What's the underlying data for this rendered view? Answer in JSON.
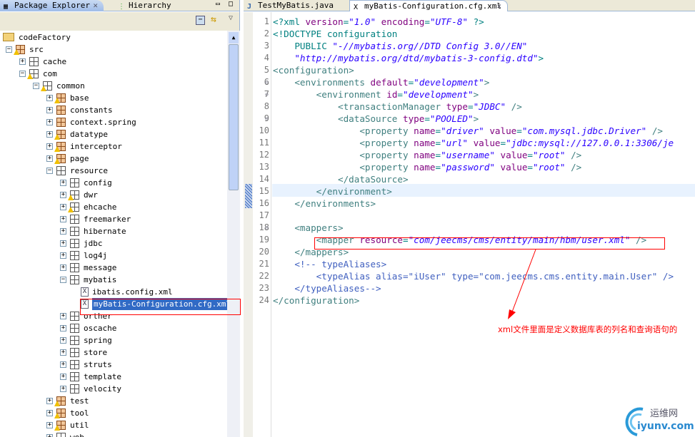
{
  "left_panel": {
    "tabs": [
      {
        "label": "Package Explorer",
        "icon": "package-explorer-icon"
      },
      {
        "label": "Hierarchy",
        "icon": "hierarchy-icon"
      }
    ],
    "tree": [
      {
        "label": "codeFactory",
        "level": 0,
        "type": "project",
        "expander": ""
      },
      {
        "label": "src",
        "level": 0,
        "type": "srcfolder",
        "expander": "-",
        "warn": true
      },
      {
        "label": "cache",
        "level": 1,
        "type": "pkg",
        "expander": "+"
      },
      {
        "label": "com",
        "level": 1,
        "type": "pkg",
        "expander": "-",
        "warn": true
      },
      {
        "label": "common",
        "level": 2,
        "type": "pkg",
        "expander": "-",
        "warn": true
      },
      {
        "label": "base",
        "level": 3,
        "type": "src",
        "expander": "+",
        "warn": true
      },
      {
        "label": "constants",
        "level": 3,
        "type": "src",
        "expander": "+"
      },
      {
        "label": "context.spring",
        "level": 3,
        "type": "src",
        "expander": "+"
      },
      {
        "label": "datatype",
        "level": 3,
        "type": "src",
        "expander": "+",
        "warn": true
      },
      {
        "label": "interceptor",
        "level": 3,
        "type": "src",
        "expander": "+",
        "warn": true
      },
      {
        "label": "page",
        "level": 3,
        "type": "src",
        "expander": "+",
        "warn": true
      },
      {
        "label": "resource",
        "level": 3,
        "type": "pkg",
        "expander": "-"
      },
      {
        "label": "config",
        "level": 4,
        "type": "pkg",
        "expander": "+"
      },
      {
        "label": "dwr",
        "level": 4,
        "type": "pkg",
        "expander": "+",
        "warn": true
      },
      {
        "label": "ehcache",
        "level": 4,
        "type": "pkg",
        "expander": "+",
        "warn": true
      },
      {
        "label": "freemarker",
        "level": 4,
        "type": "pkg",
        "expander": "+"
      },
      {
        "label": "hibernate",
        "level": 4,
        "type": "pkg",
        "expander": "+"
      },
      {
        "label": "jdbc",
        "level": 4,
        "type": "pkg",
        "expander": "+"
      },
      {
        "label": "log4j",
        "level": 4,
        "type": "pkg",
        "expander": "+"
      },
      {
        "label": "message",
        "level": 4,
        "type": "pkg",
        "expander": "+"
      },
      {
        "label": "mybatis",
        "level": 4,
        "type": "pkg",
        "expander": "-"
      },
      {
        "label": "ibatis.config.xml",
        "level": 5,
        "type": "xml",
        "expander": ""
      },
      {
        "label": "myBatis-Configuration.cfg.xml",
        "level": 5,
        "type": "xml",
        "expander": "",
        "selected": true
      },
      {
        "label": "orther",
        "level": 4,
        "type": "pkg",
        "expander": "+"
      },
      {
        "label": "oscache",
        "level": 4,
        "type": "pkg",
        "expander": "+"
      },
      {
        "label": "spring",
        "level": 4,
        "type": "pkg",
        "expander": "+"
      },
      {
        "label": "store",
        "level": 4,
        "type": "pkg",
        "expander": "+"
      },
      {
        "label": "struts",
        "level": 4,
        "type": "pkg",
        "expander": "+"
      },
      {
        "label": "template",
        "level": 4,
        "type": "pkg",
        "expander": "+"
      },
      {
        "label": "velocity",
        "level": 4,
        "type": "pkg",
        "expander": "+"
      },
      {
        "label": "test",
        "level": 3,
        "type": "src",
        "expander": "+",
        "warn": true
      },
      {
        "label": "tool",
        "level": 3,
        "type": "src",
        "expander": "+",
        "warn": true
      },
      {
        "label": "util",
        "level": 3,
        "type": "src",
        "expander": "+",
        "warn": true
      },
      {
        "label": "web",
        "level": 3,
        "type": "pkg",
        "expander": "+"
      }
    ]
  },
  "editor": {
    "tabs": [
      {
        "label": "TestMyBatis.java",
        "icon": "java-file-icon"
      },
      {
        "label": "myBatis-Configuration.cfg.xml",
        "icon": "xml-file-icon"
      }
    ],
    "lines": [
      [
        [
          "p",
          "<?xml "
        ],
        [
          "a",
          "version"
        ],
        [
          "k",
          "="
        ],
        [
          "v",
          "\"1.0\""
        ],
        [
          "a",
          " encoding"
        ],
        [
          "k",
          "="
        ],
        [
          "v",
          "\"UTF-8\""
        ],
        [
          "p",
          " ?>"
        ]
      ],
      [
        [
          "p",
          "<!DOCTYPE configuration"
        ]
      ],
      [
        [
          "p",
          "    PUBLIC "
        ],
        [
          "v",
          "\"-//mybatis.org//DTD Config 3.0//EN\""
        ]
      ],
      [
        [
          "v",
          "    \"http://mybatis.org/dtd/mybatis-3-config.dtd\""
        ],
        [
          "p",
          ">"
        ]
      ],
      [
        [
          "t",
          "<configuration>"
        ]
      ],
      [
        [
          "t",
          "    <environments "
        ],
        [
          "a",
          "default"
        ],
        [
          "k",
          "="
        ],
        [
          "v",
          "\"development\""
        ],
        [
          "t",
          ">"
        ]
      ],
      [
        [
          "t",
          "        <environment "
        ],
        [
          "a",
          "id"
        ],
        [
          "k",
          "="
        ],
        [
          "v",
          "\"development\""
        ],
        [
          "t",
          ">"
        ]
      ],
      [
        [
          "t",
          "            <transactionManager "
        ],
        [
          "a",
          "type"
        ],
        [
          "k",
          "="
        ],
        [
          "v",
          "\"JDBC\""
        ],
        [
          "t",
          " />"
        ]
      ],
      [
        [
          "t",
          "            <dataSource "
        ],
        [
          "a",
          "type"
        ],
        [
          "k",
          "="
        ],
        [
          "v",
          "\"POOLED\""
        ],
        [
          "t",
          ">"
        ]
      ],
      [
        [
          "t",
          "                <property "
        ],
        [
          "a",
          "name"
        ],
        [
          "k",
          "="
        ],
        [
          "v",
          "\"driver\""
        ],
        [
          "a",
          " value"
        ],
        [
          "k",
          "="
        ],
        [
          "v",
          "\"com.mysql.jdbc.Driver\""
        ],
        [
          "t",
          " />"
        ]
      ],
      [
        [
          "t",
          "                <property "
        ],
        [
          "a",
          "name"
        ],
        [
          "k",
          "="
        ],
        [
          "v",
          "\"url\""
        ],
        [
          "a",
          " value"
        ],
        [
          "k",
          "="
        ],
        [
          "v",
          "\"jdbc:mysql://127.0.0.1:3306/je"
        ]
      ],
      [
        [
          "t",
          "                <property "
        ],
        [
          "a",
          "name"
        ],
        [
          "k",
          "="
        ],
        [
          "v",
          "\"username\""
        ],
        [
          "a",
          " value"
        ],
        [
          "k",
          "="
        ],
        [
          "v",
          "\"root\""
        ],
        [
          "t",
          " />"
        ]
      ],
      [
        [
          "t",
          "                <property "
        ],
        [
          "a",
          "name"
        ],
        [
          "k",
          "="
        ],
        [
          "v",
          "\"password\""
        ],
        [
          "a",
          " value"
        ],
        [
          "k",
          "="
        ],
        [
          "v",
          "\"root\""
        ],
        [
          "t",
          " />"
        ]
      ],
      [
        [
          "t",
          "            </dataSource>"
        ]
      ],
      [
        [
          "t",
          "        </environment>"
        ]
      ],
      [
        [
          "t",
          "    </environments>"
        ]
      ],
      [
        [
          "t",
          ""
        ]
      ],
      [
        [
          "t",
          "    <mappers>"
        ]
      ],
      [
        [
          "t",
          "        <mapper "
        ],
        [
          "a",
          "resource"
        ],
        [
          "k",
          "="
        ],
        [
          "v",
          "\"com/jeecms/cms/entity/main/hbm/user.xml\""
        ],
        [
          "t",
          " />"
        ]
      ],
      [
        [
          "t",
          "    </mappers>"
        ]
      ],
      [
        [
          "c",
          "    <!-- typeAliases>"
        ]
      ],
      [
        [
          "c",
          "        <typeAlias alias=\"iUser\" type=\"com.jeecms.cms.entity.main.User\" />"
        ]
      ],
      [
        [
          "c",
          "    </typeAliases-->"
        ]
      ],
      [
        [
          "t",
          "</configuration>"
        ]
      ]
    ],
    "fold_lines": [
      6,
      7,
      9,
      18
    ]
  },
  "annotation": {
    "text": "xml文件里面是定义数据库表的列名和查询语句的",
    "color": "#ff0000"
  },
  "watermark": {
    "cn": "运维网",
    "en": "iyunv.com"
  }
}
